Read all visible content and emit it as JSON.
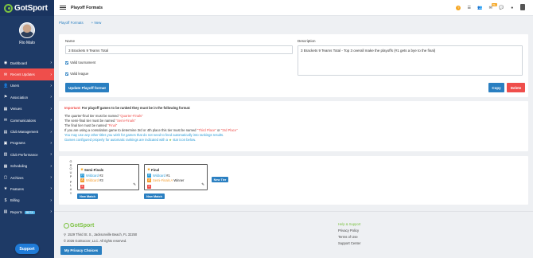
{
  "brand": {
    "name": "GotSport",
    "footer_name": "GotSport"
  },
  "user": {
    "name": "Rio Malo"
  },
  "sidebar": {
    "items": [
      {
        "label": "Dashboard",
        "icon": "dashboard-icon",
        "glyph": "◉",
        "active": false,
        "beta": ""
      },
      {
        "label": "Recent Updates",
        "icon": "updates-icon",
        "glyph": "✉",
        "active": true,
        "beta": ""
      },
      {
        "label": "Users",
        "icon": "users-icon",
        "glyph": "👤",
        "active": false,
        "beta": ""
      },
      {
        "label": "Association",
        "icon": "association-icon",
        "glyph": "⚑",
        "active": false,
        "beta": ""
      },
      {
        "label": "Venues",
        "icon": "venues-icon",
        "glyph": "▦",
        "active": false,
        "beta": ""
      },
      {
        "label": "Communications",
        "icon": "communications-icon",
        "glyph": "✉",
        "active": false,
        "beta": ""
      },
      {
        "label": "Club Management",
        "icon": "club-management-icon",
        "glyph": "▤",
        "active": false,
        "beta": ""
      },
      {
        "label": "Programs",
        "icon": "programs-icon",
        "glyph": "▣",
        "active": false,
        "beta": ""
      },
      {
        "label": "Club Performance",
        "icon": "club-performance-icon",
        "glyph": "▥",
        "active": false,
        "beta": ""
      },
      {
        "label": "Scheduling",
        "icon": "scheduling-icon",
        "glyph": "▦",
        "active": false,
        "beta": ""
      },
      {
        "label": "Archives",
        "icon": "archives-icon",
        "glyph": "▢",
        "active": false,
        "beta": ""
      },
      {
        "label": "Features",
        "icon": "features-icon",
        "glyph": "★",
        "active": false,
        "beta": ""
      },
      {
        "label": "Billing",
        "icon": "billing-icon",
        "glyph": "$",
        "active": false,
        "beta": ""
      },
      {
        "label": "Reports",
        "icon": "reports-icon",
        "glyph": "▤",
        "active": false,
        "beta": "BETA"
      }
    ],
    "support_label": "Support"
  },
  "topbar": {
    "title": "Playoff Formats",
    "mail_badge": "99+",
    "icons": [
      "help-icon",
      "list-icon",
      "people-icon",
      "mail-icon",
      "chat-icon",
      "info-icon",
      "user-icon"
    ]
  },
  "subnav": {
    "link": "Playoff Formats",
    "new_label": "+ New"
  },
  "form": {
    "name_label": "Name",
    "name_value": "3 Brackets 9 Teams Total",
    "description_label": "Description",
    "description_value": "3 Brackets 9 Teams Total - Top 3 overall make the playoffs (#1 gets a bye to the final)",
    "valid_tournament": "Valid tournament",
    "valid_league": "Valid league",
    "update_button": "Update Playoff format",
    "copy_button": "Copy",
    "delete_button": "Delete"
  },
  "info": {
    "important": "Important:",
    "head_rest": " For playoff games to be ranked they must be in the following format:",
    "qf_pre": "The quarter-final tier must be named ",
    "qf_name": "\"Quarter-Finals\"",
    "sf_pre": "The semi-final tier must be named ",
    "sf_name": "\"Semi-Finals\"",
    "f_pre": "The final tier must be named ",
    "f_name": "\"Final\"",
    "cons_pre": "If you are using a consolation game to determine 3rd or 4th place this tier must be named ",
    "cons_name1": "\"Third Place\"",
    "cons_or": " or ",
    "cons_name2": "\"3rd Place\"",
    "note1": "You may use any other titles you wish for games that do not need to feed automatically into rankings results.",
    "note2_pre": "Games configured properly for automatic rankings are indicated with a ",
    "note2_star": "★",
    "note2_post": " star icon below."
  },
  "bracket": {
    "group_label": "GROUPPLAY",
    "semi": {
      "title": "Semi-Finals",
      "slot1_label": "Wildcard",
      "slot1_value": "#2",
      "slot2_label": "Wildcard",
      "slot2_value": "#3"
    },
    "final": {
      "title": "Final",
      "slot1_label": "Wildcard",
      "slot1_value": "#1",
      "slot2_label": "Semi-Finals A",
      "slot2_value": "Winner"
    },
    "new_match": "New Match",
    "new_tier": "New Tier"
  },
  "footer": {
    "address": "1529 Third St. S., Jacksonville Beach, FL 32250",
    "copyright": "© 2026 GotSoccer, LLC. All rights reserved.",
    "links": [
      "Help & Support",
      "Privacy Policy",
      "Terms of Use",
      "Support Center"
    ],
    "privacy_button": "My Privacy Choices"
  }
}
